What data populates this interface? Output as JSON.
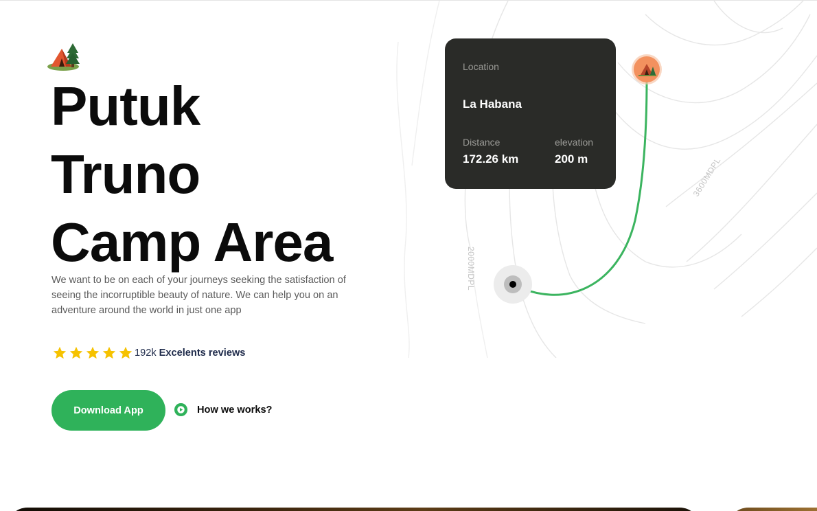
{
  "hero": {
    "title_lines": [
      "Putuk",
      "Truno",
      "Camp Area"
    ],
    "description": "We want to be on each of your journeys seeking the satisfaction of seeing the incorruptible beauty of nature. We can help you on an adventure around the world in just one app",
    "rating": {
      "stars": 5,
      "count": "192k",
      "label": "Excelents reviews",
      "star_color": "#f6c200"
    },
    "download_button": "Download App",
    "how_link": "How we works?",
    "accent_color": "#2fb25a"
  },
  "card": {
    "location_label": "Location",
    "location_value": "La Habana",
    "distance_label": "Distance",
    "distance_value": "172.26 km",
    "elevation_label": "elevation",
    "elevation_value": "200 m"
  },
  "map": {
    "contour_labels": [
      "2000MDPL",
      "3600MDPL"
    ],
    "start_marker_icon": "location-dot-icon",
    "end_marker_icon": "camp-tent-icon",
    "route_color": "#3bb45f",
    "end_marker_color": "#f3915e"
  },
  "icons": {
    "logo": "camp-tent-icon",
    "play": "play-circle-icon",
    "star": "star-icon"
  }
}
